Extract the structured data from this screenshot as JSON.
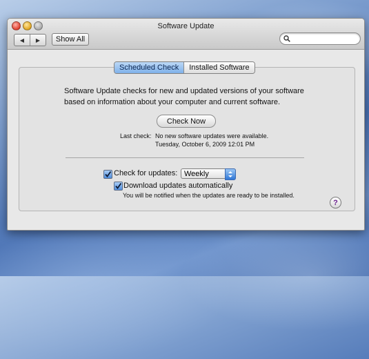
{
  "window": {
    "title": "Software Update"
  },
  "toolbar": {
    "back_glyph": "◀",
    "forward_glyph": "▶",
    "show_all_label": "Show All",
    "search_placeholder": ""
  },
  "tabs": [
    {
      "label": "Scheduled Check",
      "selected": true
    },
    {
      "label": "Installed Software",
      "selected": false
    }
  ],
  "main": {
    "description": "Software Update checks for new and updated versions of your software based on information about your computer and current software.",
    "check_now_label": "Check Now",
    "last_check_label": "Last check:",
    "last_check_status": "No new software updates were available.",
    "last_check_time": "Tuesday, October 6, 2009 12:01 PM",
    "check_for_updates_label": "Check for updates:",
    "check_for_updates_checked": true,
    "frequency_selected": "Weekly",
    "download_auto_label": "Download updates automatically",
    "download_auto_checked": true,
    "notify_note": "You will be notified when the updates are ready to be installed.",
    "help_glyph": "?"
  },
  "colors": {
    "accent": "#4f8ddd",
    "help_question": "#6b1f8f"
  },
  "icons": {
    "back": "back-arrow-icon",
    "forward": "forward-arrow-icon",
    "search": "magnifier-icon",
    "help": "help-icon"
  }
}
